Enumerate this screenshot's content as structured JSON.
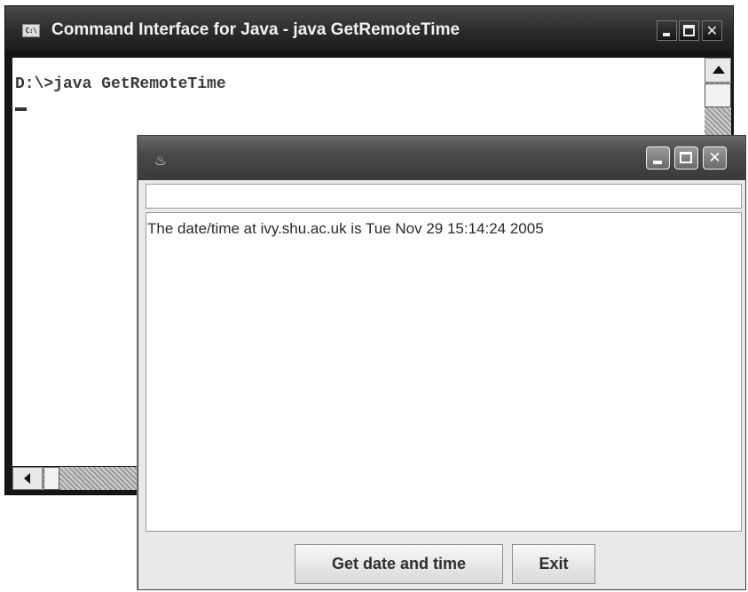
{
  "cmd_window": {
    "title": "Command Interface for Java - java GetRemoteTime",
    "system_icon_text": "C:\\",
    "command_line": "D:\\>java GetRemoteTime"
  },
  "java_window": {
    "text_field_value": "",
    "output_text": "The date/time at ivy.shu.ac.uk is Tue Nov 29 15:14:24 2005",
    "buttons": {
      "get_date_time": "Get date and time",
      "exit": "Exit"
    }
  },
  "icons": {
    "cmd_system": "console-icon",
    "java": "java-cup-icon"
  }
}
